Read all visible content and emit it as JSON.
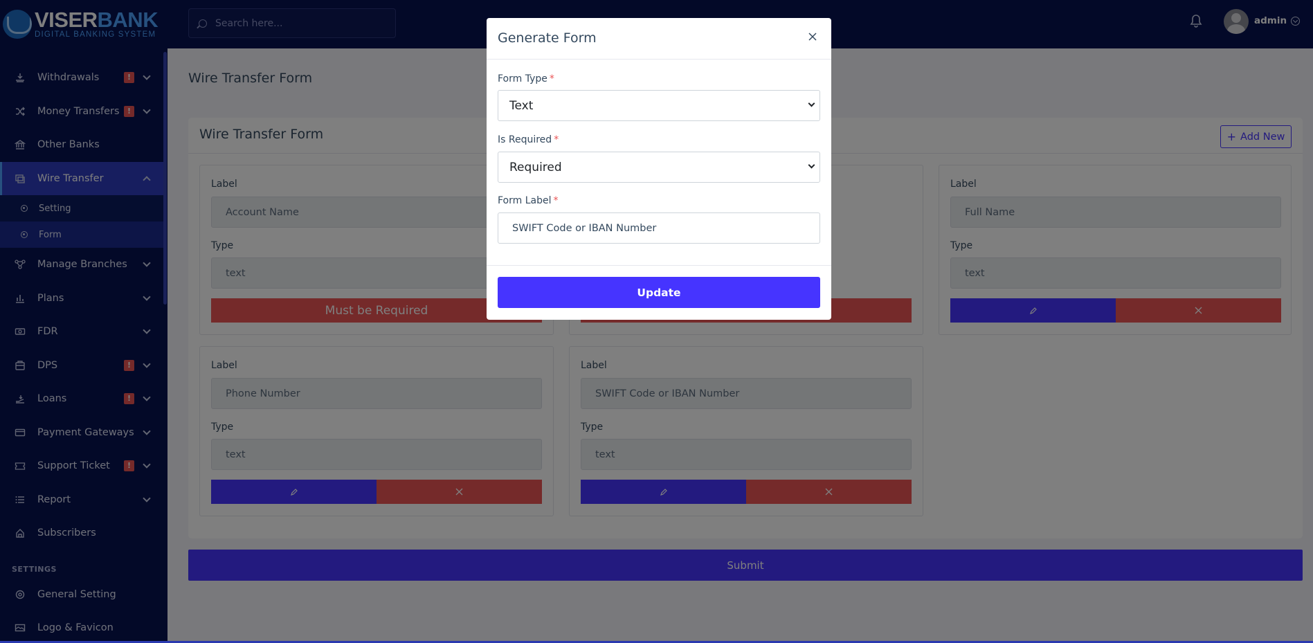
{
  "brand": {
    "name_part1": "VISER",
    "name_part2": "BANK",
    "tagline": "DIGITAL BANKING SYSTEM"
  },
  "topbar": {
    "search_placeholder": "Search here...",
    "user_name": "admin"
  },
  "sidebar": {
    "items": [
      {
        "label": "Withdrawals",
        "badge": "!",
        "icon": "withdraw-icon"
      },
      {
        "label": "Money Transfers",
        "badge": "!",
        "icon": "shuffle-icon"
      },
      {
        "label": "Other Banks",
        "icon": "bank-icon"
      },
      {
        "label": "Wire Transfer",
        "icon": "wire-transfer-icon",
        "active": true
      },
      {
        "label": "Manage Branches",
        "icon": "branches-icon"
      },
      {
        "label": "Plans",
        "icon": "chart-icon"
      },
      {
        "label": "FDR",
        "icon": "fdr-icon"
      },
      {
        "label": "DPS",
        "badge": "!",
        "icon": "dps-icon"
      },
      {
        "label": "Loans",
        "badge": "!",
        "icon": "loan-icon"
      },
      {
        "label": "Payment Gateways",
        "icon": "card-icon"
      },
      {
        "label": "Support Ticket",
        "badge": "!",
        "icon": "ticket-icon"
      },
      {
        "label": "Report",
        "icon": "list-icon"
      },
      {
        "label": "Subscribers",
        "icon": "subscribers-icon"
      }
    ],
    "sub_items": [
      {
        "label": "Setting"
      },
      {
        "label": "Form"
      }
    ],
    "settings_title": "SETTINGS",
    "settings_items": [
      {
        "label": "General Setting"
      },
      {
        "label": "Logo & Favicon"
      }
    ]
  },
  "page": {
    "title": "Wire Transfer Form",
    "card_title": "Wire Transfer Form",
    "add_new": "Add New",
    "submit": "Submit",
    "field_label": "Label",
    "field_type": "Type",
    "must_be_required": "Must be Required",
    "fields": [
      {
        "label_value": "Account Name",
        "type_value": "text"
      },
      {
        "label_value": "Full Name",
        "type_value": "text"
      },
      {
        "label_value": "Phone Number",
        "type_value": "text"
      },
      {
        "label_value": "SWIFT Code or IBAN Number",
        "type_value": "text"
      }
    ]
  },
  "modal": {
    "title": "Generate Form",
    "form_type_label": "Form Type",
    "form_type_value": "Text",
    "is_required_label": "Is Required",
    "is_required_value": "Required",
    "form_label_label": "Form Label",
    "form_label_value": "SWIFT Code or IBAN Number",
    "required_mark": "*",
    "update": "Update"
  },
  "colors": {
    "primary": "#4634ff",
    "danger": "#ea5455",
    "sidebar_bg": "#071251"
  }
}
